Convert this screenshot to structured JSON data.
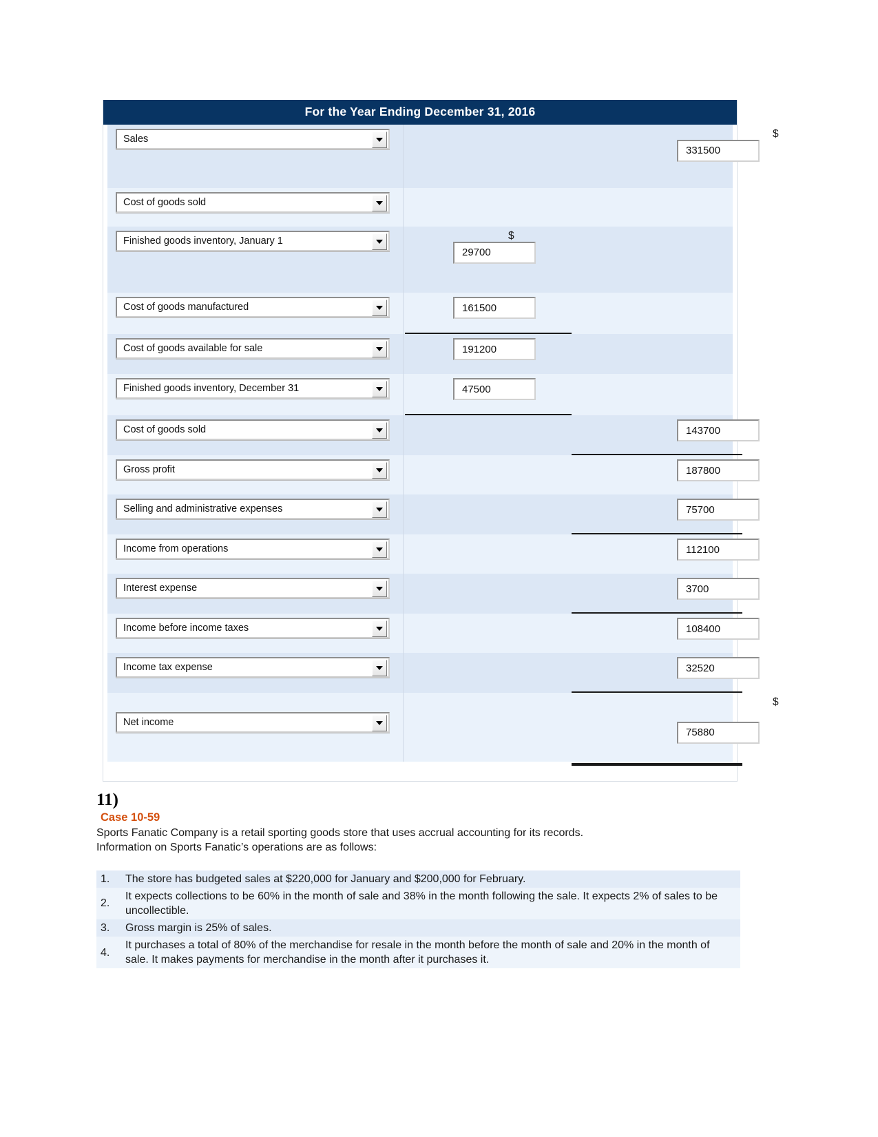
{
  "worksheet": {
    "title": "For the Year Ending December 31, 2016",
    "currency_symbol": "$",
    "rows": [
      {
        "label": "Sales",
        "mid": "",
        "right": "331500"
      },
      {
        "label": "Cost of goods sold",
        "mid": "",
        "right": ""
      },
      {
        "label": "Finished goods inventory, January 1",
        "mid": "29700",
        "right": ""
      },
      {
        "label": "Cost of goods manufactured",
        "mid": "161500",
        "right": ""
      },
      {
        "label": "Cost of goods available for sale",
        "mid": "191200",
        "right": ""
      },
      {
        "label": "Finished goods inventory, December 31",
        "mid": "47500",
        "right": ""
      },
      {
        "label": "Cost of goods sold",
        "mid": "",
        "right": "143700"
      },
      {
        "label": "Gross profit",
        "mid": "",
        "right": "187800"
      },
      {
        "label": "Selling and administrative expenses",
        "mid": "",
        "right": "75700"
      },
      {
        "label": "Income from operations",
        "mid": "",
        "right": "112100"
      },
      {
        "label": "Interest expense",
        "mid": "",
        "right": "3700"
      },
      {
        "label": "Income before income taxes",
        "mid": "",
        "right": "108400"
      },
      {
        "label": "Income tax expense",
        "mid": "",
        "right": "32520"
      },
      {
        "label": "Net income",
        "mid": "",
        "right": "75880"
      }
    ]
  },
  "question": {
    "number": "11)",
    "case_title": "Case 10-59",
    "intro_line_1": "Sports Fanatic Company is a retail sporting goods store that uses accrual accounting for its records.",
    "intro_line_2": "Information on Sports Fanatic’s operations are as follows:",
    "items": [
      {
        "marker": "1.",
        "text": "The store has budgeted sales at $220,000 for January and $200,000 for February."
      },
      {
        "marker": "2.",
        "text": "It expects collections to be 60% in the month of sale and 38% in the month following the sale. It expects 2% of sales to be uncollectible."
      },
      {
        "marker": "3.",
        "text": "Gross margin is 25% of sales."
      },
      {
        "marker": "4.",
        "text": "It purchases a total of 80% of the merchandise for resale in the month before the month of sale and 20% in the month of sale. It makes payments for merchandise in the month after it purchases it."
      }
    ]
  },
  "colors": {
    "header_bg": "#083463",
    "band_a": "#dce7f5",
    "band_b": "#eaf2fb",
    "case_accent": "#d4500f"
  }
}
